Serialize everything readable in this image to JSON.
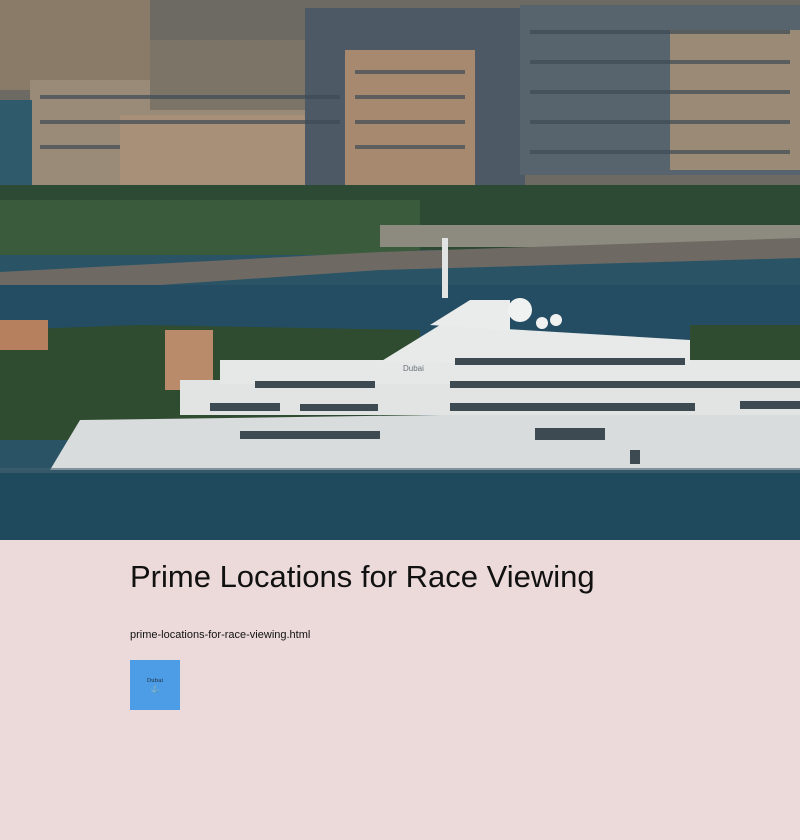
{
  "hero": {
    "yacht_name": "Dubai"
  },
  "page": {
    "title": "Prime Locations for Race Viewing",
    "file_link": "prime-locations-for-race-viewing.html"
  },
  "logo": {
    "text": "Dubai",
    "icon": "anchor-icon",
    "glyph": "⚓",
    "background_color": "#4d9de6"
  },
  "colors": {
    "page_background": "#ecdada",
    "water": "#1f4a5e"
  }
}
